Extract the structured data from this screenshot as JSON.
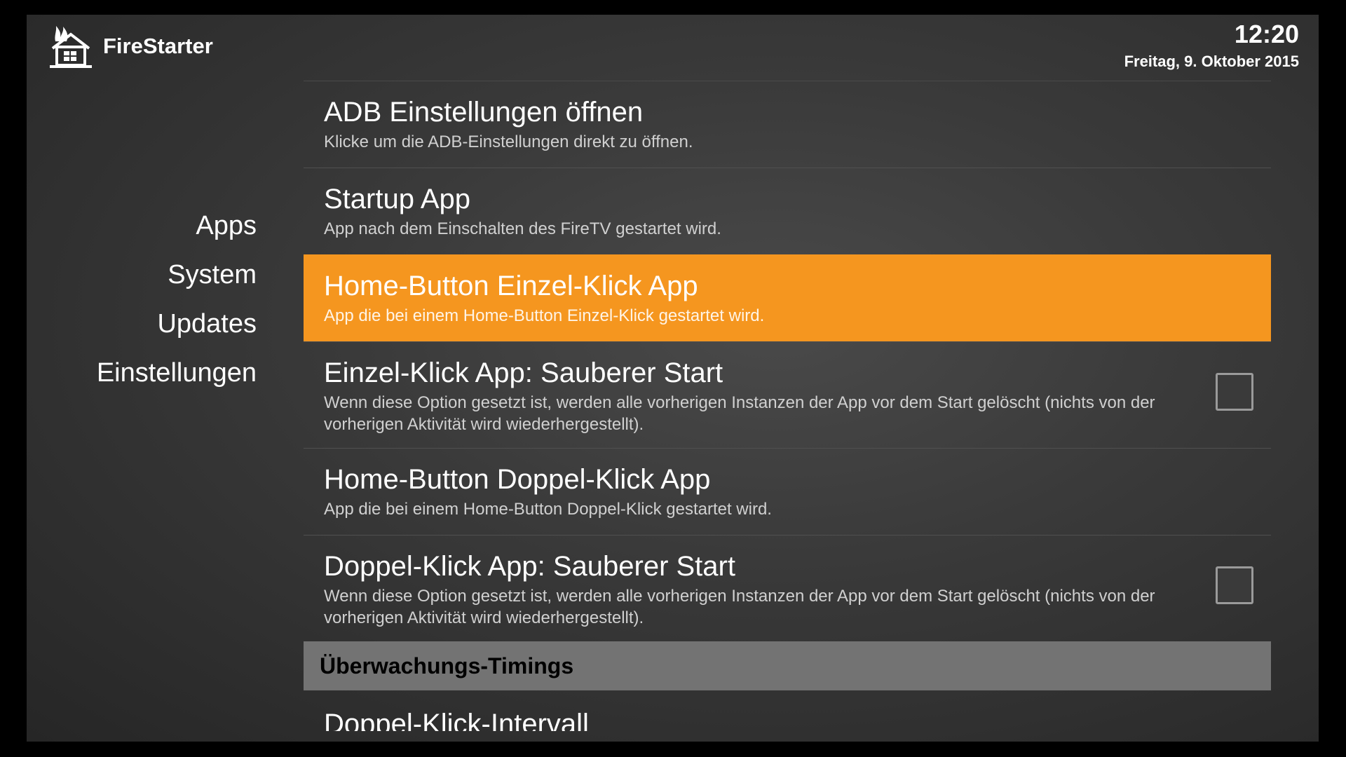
{
  "app": {
    "name": "FireStarter",
    "logo_icon": "burning-house-icon"
  },
  "clock": {
    "time": "12:20",
    "date": "Freitag, 9. Oktober 2015"
  },
  "nav": {
    "items": [
      {
        "label": "Apps"
      },
      {
        "label": "System"
      },
      {
        "label": "Updates"
      },
      {
        "label": "Einstellungen"
      }
    ]
  },
  "settings": {
    "items": [
      {
        "title": "ADB Einstellungen öffnen",
        "desc": "Klicke um die ADB-Einstellungen direkt zu öffnen."
      },
      {
        "title": "Startup App",
        "desc": "App nach dem Einschalten des FireTV gestartet wird."
      },
      {
        "title": "Home-Button Einzel-Klick App",
        "desc": "App die bei einem Home-Button Einzel-Klick gestartet wird.",
        "selected": true
      },
      {
        "title": "Einzel-Klick App: Sauberer Start",
        "desc": "Wenn diese Option gesetzt ist, werden alle vorherigen Instanzen der App vor dem Start gelöscht (nichts von der vorherigen Aktivität wird wiederhergestellt).",
        "checked": false
      },
      {
        "title": "Home-Button Doppel-Klick App",
        "desc": "App die bei einem Home-Button Doppel-Klick gestartet wird."
      },
      {
        "title": "Doppel-Klick App: Sauberer Start",
        "desc": "Wenn diese Option gesetzt ist, werden alle vorherigen Instanzen der App vor dem Start gelöscht (nichts von der vorherigen Aktivität wird wiederhergestellt).",
        "checked": false
      }
    ],
    "section_header": "Überwachungs-Timings",
    "partial_item_title": "Doppel-Klick-Intervall"
  },
  "colors": {
    "accent": "#f5961f",
    "section_header_bg": "#737373",
    "background": "#3a3a3a"
  }
}
